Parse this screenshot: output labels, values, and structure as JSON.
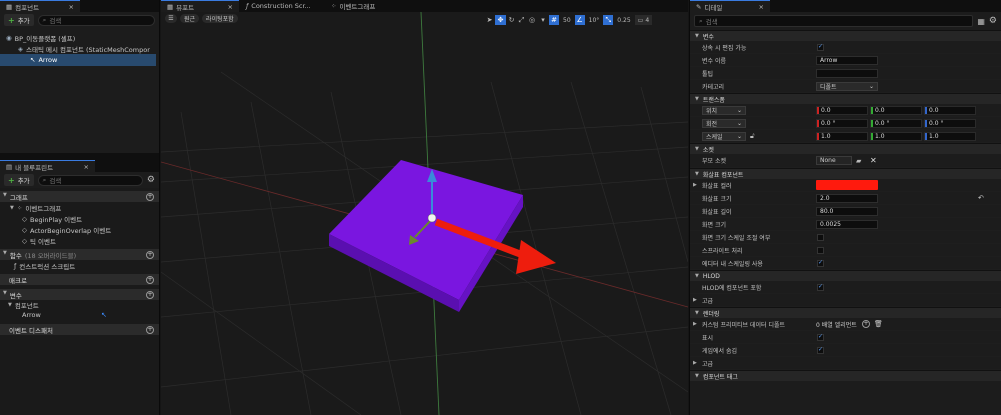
{
  "components_panel": {
    "tab": "컴포넌트",
    "add_label": "추가",
    "search_placeholder": "검색",
    "tree": [
      "BP_이동플랫폼 (셀프)",
      "스태틱 메시 컴포넌트 (StaticMeshCompor",
      "Arrow"
    ]
  },
  "viewport_tabs": [
    "뷰포트",
    "Construction Scr...",
    "이벤트그래프"
  ],
  "viewport_toolbar": {
    "view_mode": "원근",
    "lighting": "라이팅포함",
    "grid_snap": "50",
    "rotate_snap": "10°",
    "scale_snap": "0.25",
    "camera_speed": "4"
  },
  "blueprint_panel": {
    "tab": "내 블루프린트",
    "add_label": "추가",
    "search_placeholder": "검색",
    "graph_section": "그래프",
    "event_graph": "이벤트그래프",
    "events": [
      "BeginPlay 이벤트",
      "ActorBeginOverlap 이벤트",
      "틱 이벤트"
    ],
    "functions_section": "함수",
    "functions_count": "(18 오버라이드블)",
    "construction_script": "컨스트럭션 스크립트",
    "macros_section": "매크로",
    "variables_section": "변수",
    "components_label": "컴포넌트",
    "arrow_var": "Arrow",
    "dispatchers_section": "이벤트 디스패처"
  },
  "details_panel": {
    "tab": "디테일",
    "search_placeholder": "검색",
    "variable_section": "변수",
    "rows_var": [
      {
        "label": "상속 시 편집 가능",
        "value": "✓"
      },
      {
        "label": "변수 이름",
        "value": "Arrow"
      },
      {
        "label": "툴팁",
        "value": ""
      },
      {
        "label": "카테고리",
        "value": "디폴트"
      }
    ],
    "transform_section": "트랜스폼",
    "location_label": "위치",
    "rotation_label": "회전",
    "scale_label": "스케일",
    "location": [
      "0.0",
      "0.0",
      "0.0"
    ],
    "rotation": [
      "0.0 °",
      "0.0 °",
      "0.0 °"
    ],
    "scale": [
      "1.0",
      "1.0",
      "1.0"
    ],
    "sockets_section": "소켓",
    "parent_socket_label": "부모 소켓",
    "parent_socket_value": "None",
    "arrow_section": "화살표 컴포넌트",
    "arrow_color_label": "화살표 컬러",
    "arrow_color": "#ff1a0d",
    "arrow_size_label": "화살표 크기",
    "arrow_size": "2.0",
    "arrow_length_label": "화살표 길이",
    "arrow_length": "80.0",
    "screen_size_label": "화면 크기",
    "screen_size": "0.0025",
    "screen_scale_label": "화면 크기 스케일 조절 여부",
    "sprite_label": "스프라이트 처리",
    "editor_scale_label": "에디터 내 스케일링 사용",
    "hlod_section": "HLOD",
    "hlod_include_label": "HLOD에 컴포넌트 포함",
    "advanced_label": "고급",
    "rendering_section": "렌더링",
    "custom_prim_label": "커스텀 프리미티브 데이터 디폴트",
    "custom_prim_value": "0 배열 엘리먼트",
    "visible_label": "표시",
    "hidden_in_game_label": "게임에서 숨김",
    "advanced2_label": "고급",
    "bottom_partial": "컴포넌트 태그"
  }
}
